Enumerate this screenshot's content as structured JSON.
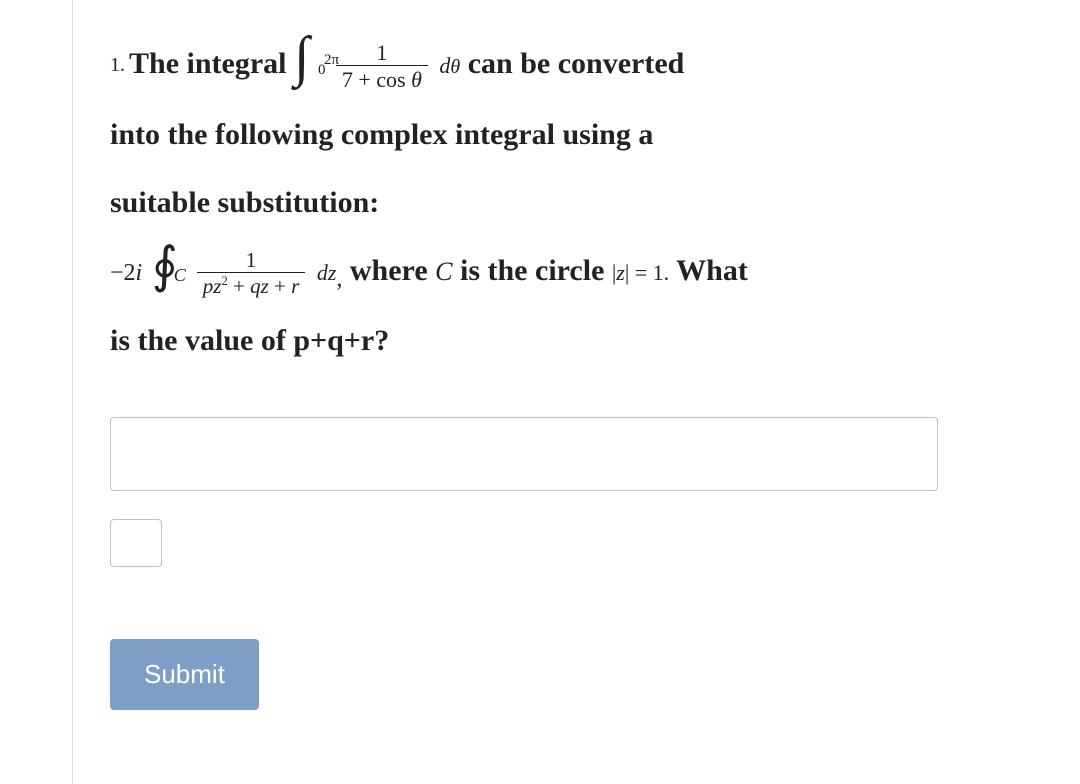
{
  "question": {
    "number": "1.",
    "t_the_integral": "The integral ",
    "int1_upper": "2π",
    "int1_lower": "0",
    "frac1_num": "1",
    "frac1_den_text": "7 + cos θ",
    "d_theta": "dθ",
    "t_can_be": " can be converted",
    "line2": "into the following complex integral using a",
    "line3": "suitable substitution:",
    "coef": "−2i",
    "oint_sub": "C",
    "frac2_num": "1",
    "frac2_den_text": "pz² + qz + r",
    "dz": "dz",
    "t_where": " where ",
    "c_var": "C",
    "t_is_circle": " is the circle ",
    "circle_expr": "|z| = 1",
    "t_period": ".",
    "t_what": " What",
    "line5": "is the value of p+q+r?"
  },
  "form": {
    "answer_long_placeholder": "",
    "answer_short_placeholder": "",
    "submit_label": "Submit"
  }
}
